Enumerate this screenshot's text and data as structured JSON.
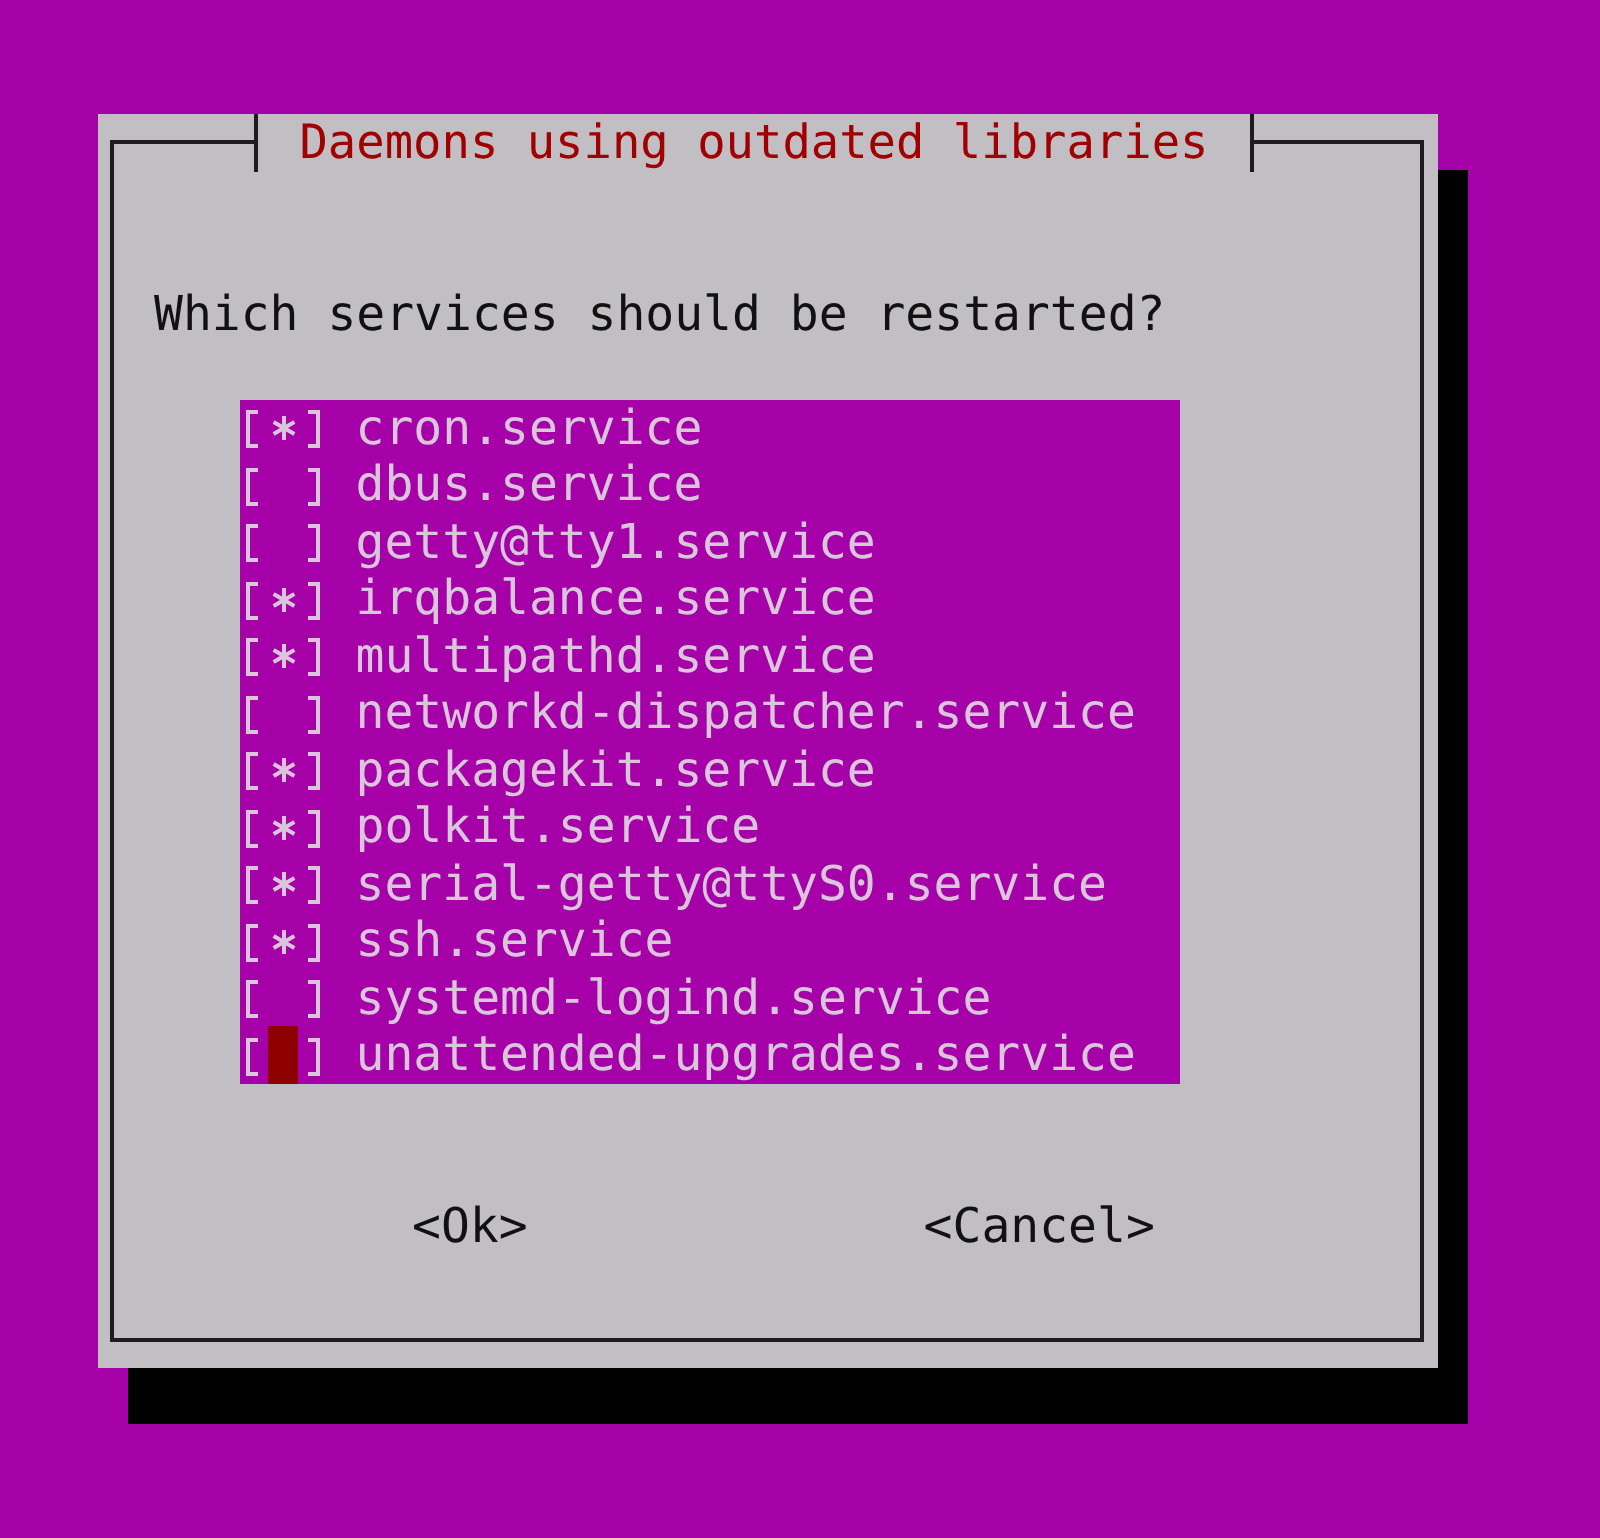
{
  "dialog": {
    "title": "Daemons using outdated libraries",
    "prompt": "Which services should be restarted?",
    "items": [
      {
        "label": "cron.service",
        "checked": true,
        "focused": false
      },
      {
        "label": "dbus.service",
        "checked": false,
        "focused": false
      },
      {
        "label": "getty@tty1.service",
        "checked": false,
        "focused": false
      },
      {
        "label": "irqbalance.service",
        "checked": true,
        "focused": false
      },
      {
        "label": "multipathd.service",
        "checked": true,
        "focused": false
      },
      {
        "label": "networkd-dispatcher.service",
        "checked": false,
        "focused": false
      },
      {
        "label": "packagekit.service",
        "checked": true,
        "focused": false
      },
      {
        "label": "polkit.service",
        "checked": true,
        "focused": false
      },
      {
        "label": "serial-getty@ttyS0.service",
        "checked": true,
        "focused": false
      },
      {
        "label": "ssh.service",
        "checked": true,
        "focused": false
      },
      {
        "label": "systemd-logind.service",
        "checked": false,
        "focused": false
      },
      {
        "label": "unattended-upgrades.service",
        "checked": false,
        "focused": true
      }
    ],
    "buttons": [
      "<Ok>",
      "<Cancel>"
    ]
  }
}
